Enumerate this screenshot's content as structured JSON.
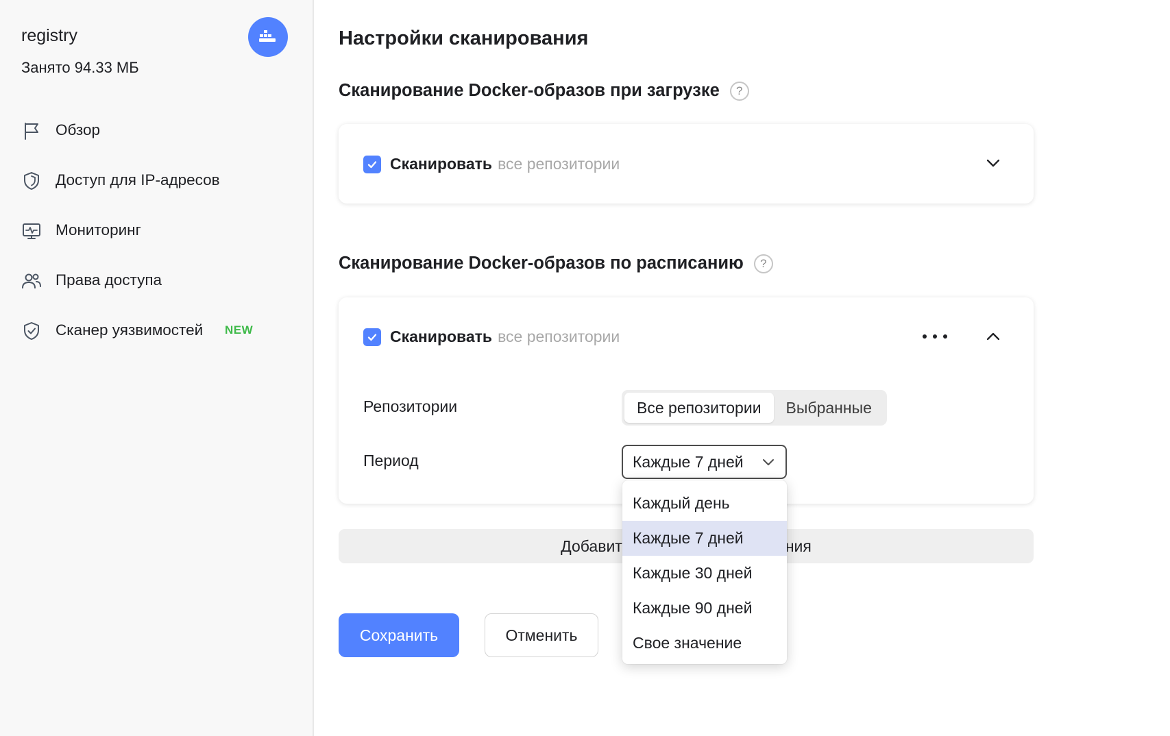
{
  "sidebar": {
    "registry_name": "registry",
    "used_space": "Занято 94.33 МБ",
    "avatar_icon": "docker-icon",
    "items": [
      {
        "label": "Обзор",
        "icon": "flag-icon"
      },
      {
        "label": "Доступ для IP-адресов",
        "icon": "shield-icon"
      },
      {
        "label": "Мониторинг",
        "icon": "monitor-icon"
      },
      {
        "label": "Права доступа",
        "icon": "users-icon"
      },
      {
        "label": "Сканер уязвимостей",
        "icon": "shield-check-icon",
        "badge": "NEW"
      }
    ]
  },
  "main": {
    "title": "Настройки сканирования",
    "upload_section": {
      "title": "Сканирование Docker-образов при загрузке",
      "help": "?",
      "rule": {
        "checked": true,
        "label": "Сканировать",
        "scope": "все репозитории"
      }
    },
    "schedule_section": {
      "title": "Сканирование Docker-образов по расписанию",
      "help": "?",
      "rule": {
        "checked": true,
        "label": "Сканировать",
        "scope": "все репозитории"
      },
      "repositories": {
        "label": "Репозитории",
        "options": [
          "Все репозитории",
          "Выбранные"
        ],
        "selected": "Все репозитории"
      },
      "period": {
        "label": "Период",
        "value": "Каждые 7 дней",
        "options": [
          "Каждый день",
          "Каждые 7 дней",
          "Каждые 30 дней",
          "Каждые 90 дней",
          "Свое значение"
        ],
        "selected": "Каждые 7 дней"
      }
    },
    "add_rule_left": "Добавит",
    "add_rule_right": "ния",
    "save": "Сохранить",
    "cancel": "Отменить"
  },
  "colors": {
    "accent": "#5282ff",
    "badge_new": "#3fba4a",
    "selected_option": "#dfe3f4"
  }
}
